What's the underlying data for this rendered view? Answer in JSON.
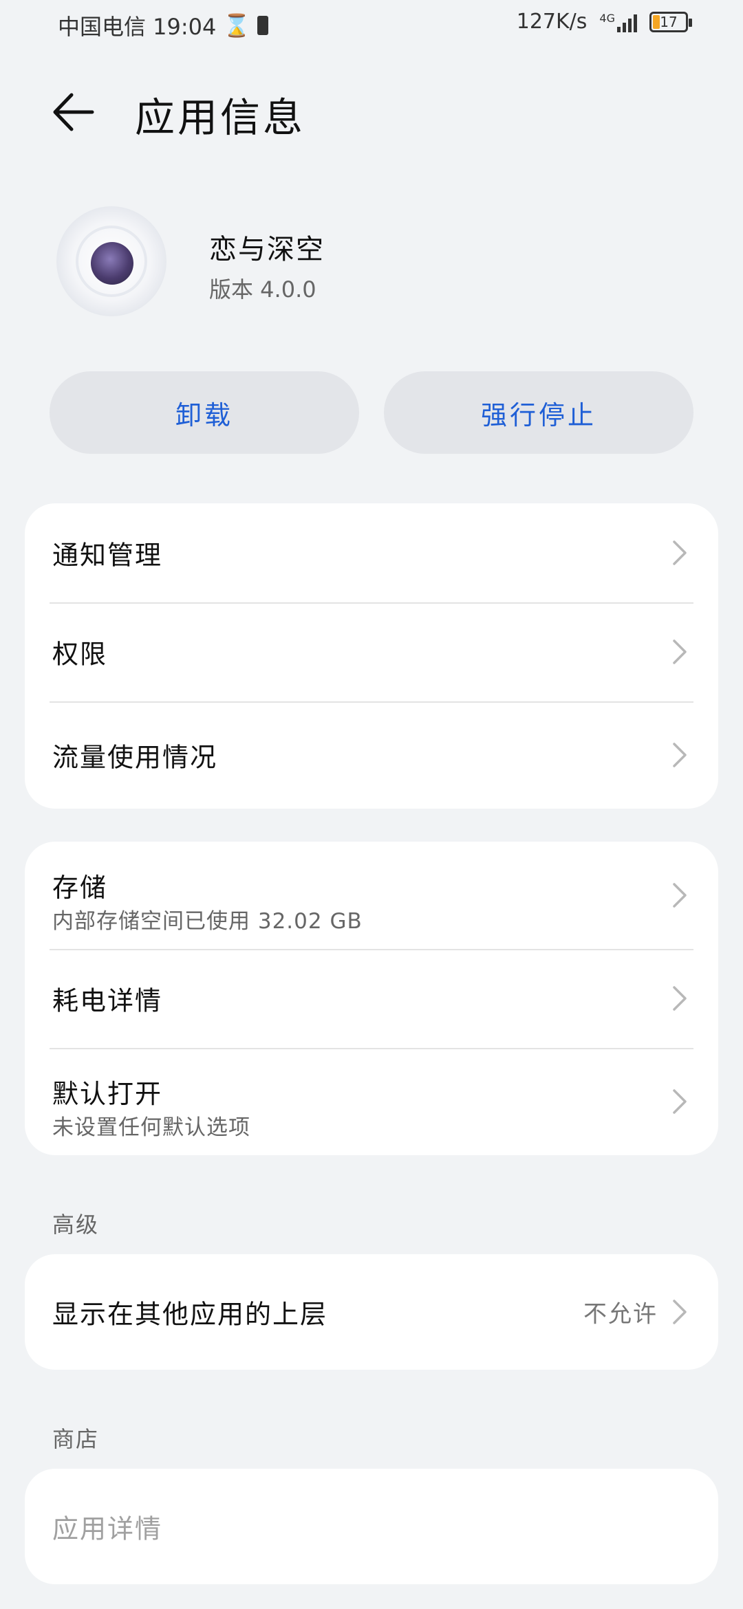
{
  "status_bar": {
    "carrier_time": "中国电信 19:04",
    "network_speed": "127K/s",
    "network_type": "4G",
    "battery": "17",
    "battery_color": "#f5a623"
  },
  "header": {
    "title": "应用信息",
    "back_icon": "back-arrow-icon"
  },
  "app": {
    "name": "恋与深空",
    "version": "版本 4.0.0"
  },
  "actions": {
    "uninstall": "卸载",
    "force_stop": "强行停止",
    "accent_color": "#1f5fd6"
  },
  "group1": {
    "items": [
      {
        "label": "通知管理"
      },
      {
        "label": "权限"
      },
      {
        "label": "流量使用情况"
      }
    ]
  },
  "group2": {
    "items": [
      {
        "label": "存储",
        "sub": "内部存储空间已使用 32.02 GB"
      },
      {
        "label": "耗电详情"
      },
      {
        "label": "默认打开",
        "sub": "未设置任何默认选项"
      }
    ]
  },
  "advanced": {
    "title": "高级",
    "items": [
      {
        "label": "显示在其他应用的上层",
        "value": "不允许"
      }
    ]
  },
  "store": {
    "title": "商店",
    "items": [
      {
        "label": "应用详情"
      }
    ]
  }
}
